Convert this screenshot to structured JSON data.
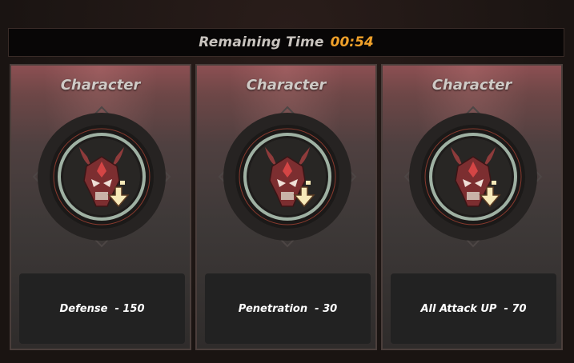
{
  "timer": {
    "label": "Remaining Time",
    "value": "00:54",
    "value_color": "#f0a12a"
  },
  "cards": [
    {
      "title": "Character",
      "icon": "demon-helmet-down-arrow-icon",
      "stat": "Defense  - 150"
    },
    {
      "title": "Character",
      "icon": "demon-helmet-down-arrow-icon",
      "stat": "Penetration  - 30"
    },
    {
      "title": "Character",
      "icon": "demon-helmet-down-arrow-icon",
      "stat": "All Attack UP  - 70"
    }
  ]
}
